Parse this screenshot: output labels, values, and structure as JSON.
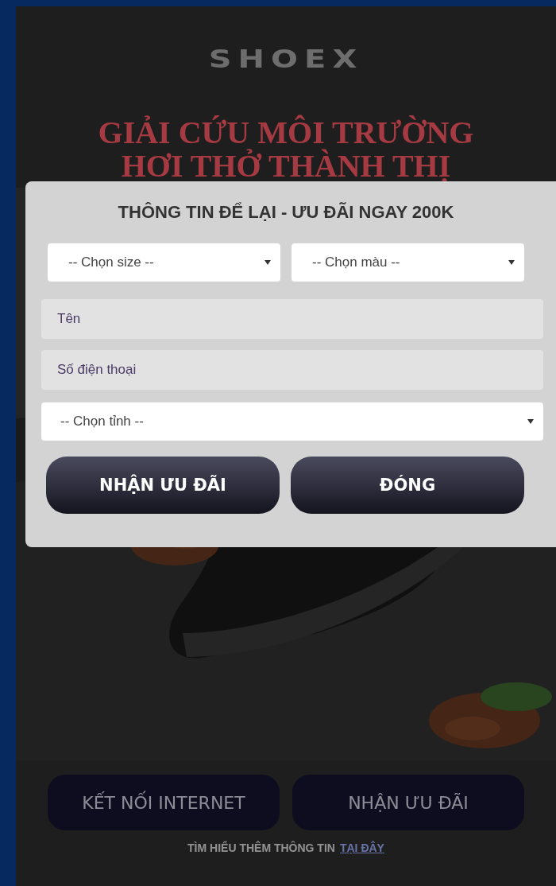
{
  "logo": "SHOEX",
  "headline": [
    "GIẢI CỨU MÔI TRƯỜNG",
    "HƠI THỞ THÀNH THỊ"
  ],
  "page_buttons": [
    "KẾT NỐI INTERNET",
    "NHẬN ƯU ĐÃI"
  ],
  "info_line": {
    "text": "TÌM HIỂU THÊM THÔNG TIN",
    "link": "TẠI ĐÂY"
  },
  "modal": {
    "title": "THÔNG TIN ĐỂ LẠI - ƯU ĐÃI NGAY 200K",
    "size_select": {
      "placeholder": "-- Chọn size --"
    },
    "color_select": {
      "placeholder": "-- Chọn màu --"
    },
    "name_field": {
      "placeholder": "Tên"
    },
    "phone_field": {
      "placeholder": "Số điện thoại"
    },
    "province_select": {
      "placeholder": "-- Chọn tỉnh --"
    },
    "buttons": [
      "NHẬN ƯU ĐÃI",
      "ĐÓNG"
    ]
  }
}
